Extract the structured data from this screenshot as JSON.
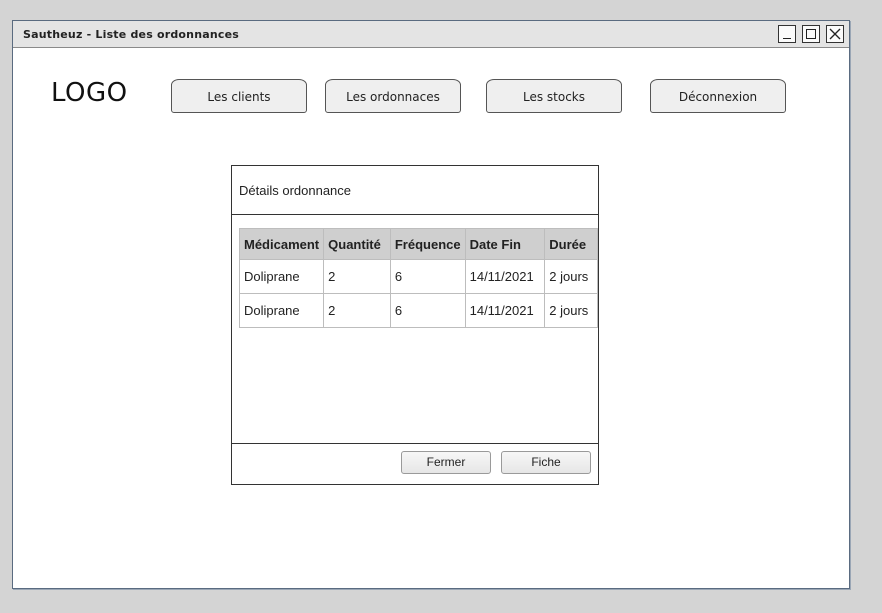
{
  "window": {
    "title": "Sautheuz - Liste des ordonnances"
  },
  "header": {
    "logo": "LOGO",
    "nav": [
      {
        "label": "Les clients"
      },
      {
        "label": "Les ordonnaces"
      },
      {
        "label": "Les stocks"
      },
      {
        "label": "Déconnexion"
      }
    ]
  },
  "dialog": {
    "title": "Détails ordonnance",
    "columns": [
      "Médicament",
      "Quantité",
      "Fréquence",
      "Date Fin",
      "Durée"
    ],
    "rows": [
      [
        "Doliprane",
        "2",
        "6",
        "14/11/2021",
        "2 jours"
      ],
      [
        "Doliprane",
        "2",
        "6",
        "14/11/2021",
        "2 jours"
      ]
    ],
    "buttons": {
      "close": "Fermer",
      "sheet": "Fiche"
    }
  },
  "icons": {
    "minimize": "minimize-icon",
    "maximize": "maximize-icon",
    "close": "close-icon"
  }
}
